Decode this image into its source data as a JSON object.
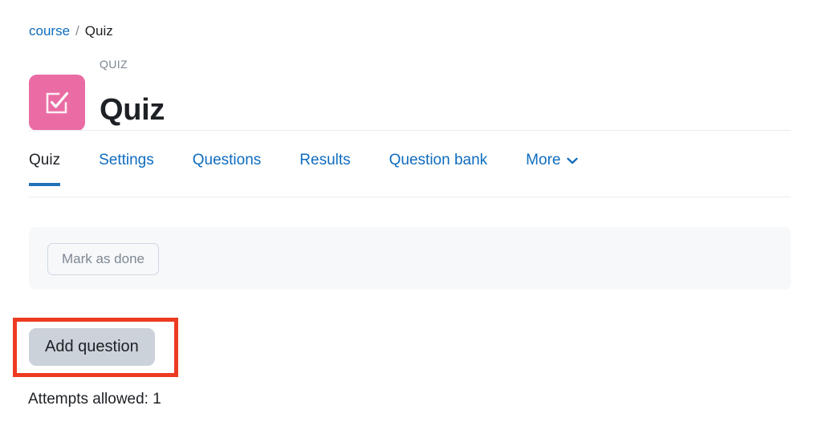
{
  "breadcrumb": {
    "course_label": "course",
    "separator": "/",
    "current_label": "Quiz"
  },
  "activity_header": {
    "icon_name": "quiz-checkbox-pen-icon",
    "icon_color": "#ea6ca4",
    "eyebrow": "QUIZ",
    "title": "Quiz"
  },
  "tabs": [
    {
      "label": "Quiz",
      "active": true
    },
    {
      "label": "Settings",
      "active": false
    },
    {
      "label": "Questions",
      "active": false
    },
    {
      "label": "Results",
      "active": false
    },
    {
      "label": "Question bank",
      "active": false
    },
    {
      "label": "More",
      "active": false,
      "has_chevron": true
    }
  ],
  "completion": {
    "mark_done_label": "Mark as done"
  },
  "actions": {
    "add_question_label": "Add question"
  },
  "annotation": {
    "color": "#ed3b22",
    "target": "add-question-button"
  },
  "info": {
    "attempts_allowed": "Attempts allowed: 1"
  },
  "colors": {
    "link": "#0f6cbf",
    "active_tab_underline": "#1f72b8",
    "panel_bg": "#f7f8fa",
    "button_bg": "#ccd2d9",
    "text": "#1d2125",
    "muted": "#7a8591"
  }
}
